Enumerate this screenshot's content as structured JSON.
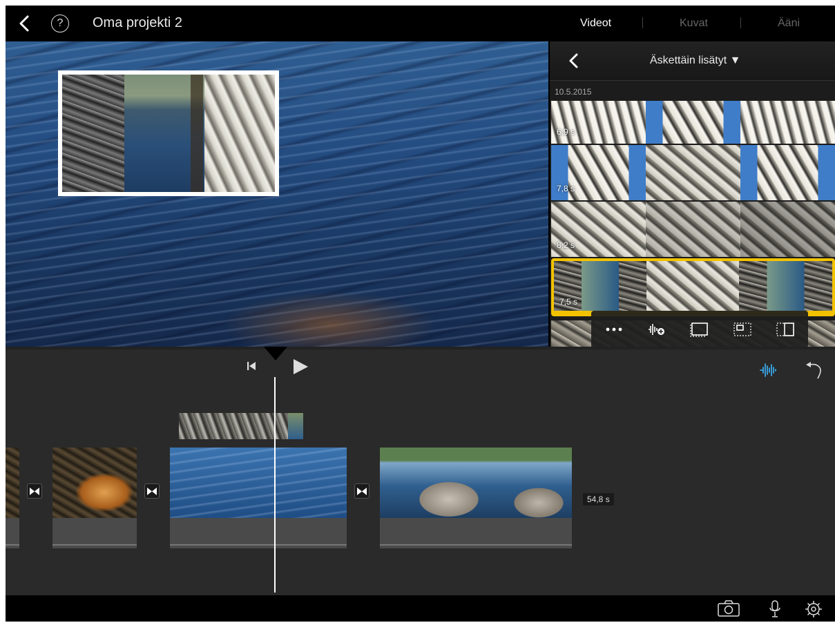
{
  "topbar": {
    "project_title": "Oma projekti 2",
    "help_label": "?",
    "media_tabs": [
      {
        "label": "Videot",
        "active": true
      },
      {
        "label": "Kuvat",
        "active": false
      },
      {
        "label": "Ääni",
        "active": false
      }
    ]
  },
  "browser": {
    "title": "Äskettäin lisätyt ▼",
    "date": "10.5.2015",
    "clips": [
      {
        "duration": "6,9 s",
        "selected": false
      },
      {
        "duration": "7,8 s",
        "selected": false
      },
      {
        "duration": "8,2 s",
        "selected": false
      },
      {
        "duration": "7,5 s",
        "selected": true
      }
    ],
    "actions": [
      "more-icon",
      "add-audio-icon",
      "cutaway-icon",
      "picture-in-picture-icon",
      "split-screen-icon"
    ],
    "selection_color": "#f2c200"
  },
  "timeline": {
    "duration_badge": "54,8 s",
    "accent_color": "#3aa6e6"
  },
  "bottombar": {
    "icons": [
      "camera-icon",
      "microphone-icon",
      "settings-icon"
    ]
  }
}
